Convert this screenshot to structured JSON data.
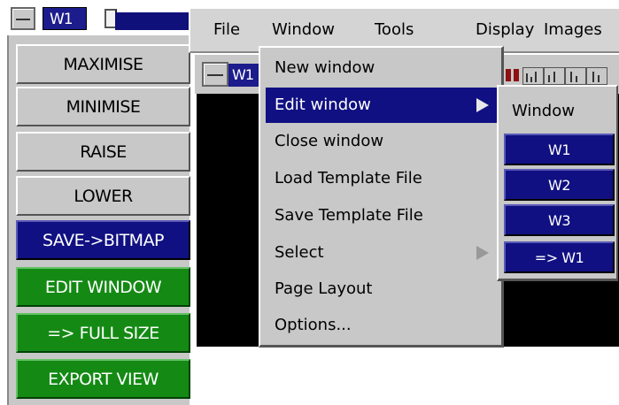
{
  "left_panel": {
    "tab_label": "W1",
    "buttons": [
      {
        "label": "MAXIMISE",
        "style": "grey"
      },
      {
        "label": "MINIMISE",
        "style": "grey"
      },
      {
        "label": "RAISE",
        "style": "grey"
      },
      {
        "label": "LOWER",
        "style": "grey"
      },
      {
        "label": "SAVE->BITMAP",
        "style": "navy"
      },
      {
        "label": "EDIT WINDOW",
        "style": "green"
      },
      {
        "label": "=> FULL SIZE",
        "style": "green"
      },
      {
        "label": "EXPORT VIEW",
        "style": "green"
      }
    ]
  },
  "menubar": {
    "items": [
      "File",
      "Window",
      "Tools",
      "Display",
      "Images"
    ]
  },
  "sub_window": {
    "tab_label": "W1"
  },
  "window_menu": {
    "items": [
      {
        "label": "New window",
        "submenu": false
      },
      {
        "label": "Edit window",
        "submenu": true,
        "active": true
      },
      {
        "label": "Close window",
        "submenu": false
      },
      {
        "label": "Load Template File",
        "submenu": false
      },
      {
        "label": "Save Template File",
        "submenu": false
      },
      {
        "label": "Select",
        "submenu": true
      },
      {
        "label": "Page Layout",
        "submenu": false
      },
      {
        "label": "Options...",
        "submenu": false
      }
    ]
  },
  "submenu": {
    "title": "Window",
    "items": [
      "W1",
      "W2",
      "W3",
      "=> W1"
    ]
  },
  "colors": {
    "navy": "#101082",
    "green": "#148a14",
    "panel_grey": "#c8c8c8"
  }
}
